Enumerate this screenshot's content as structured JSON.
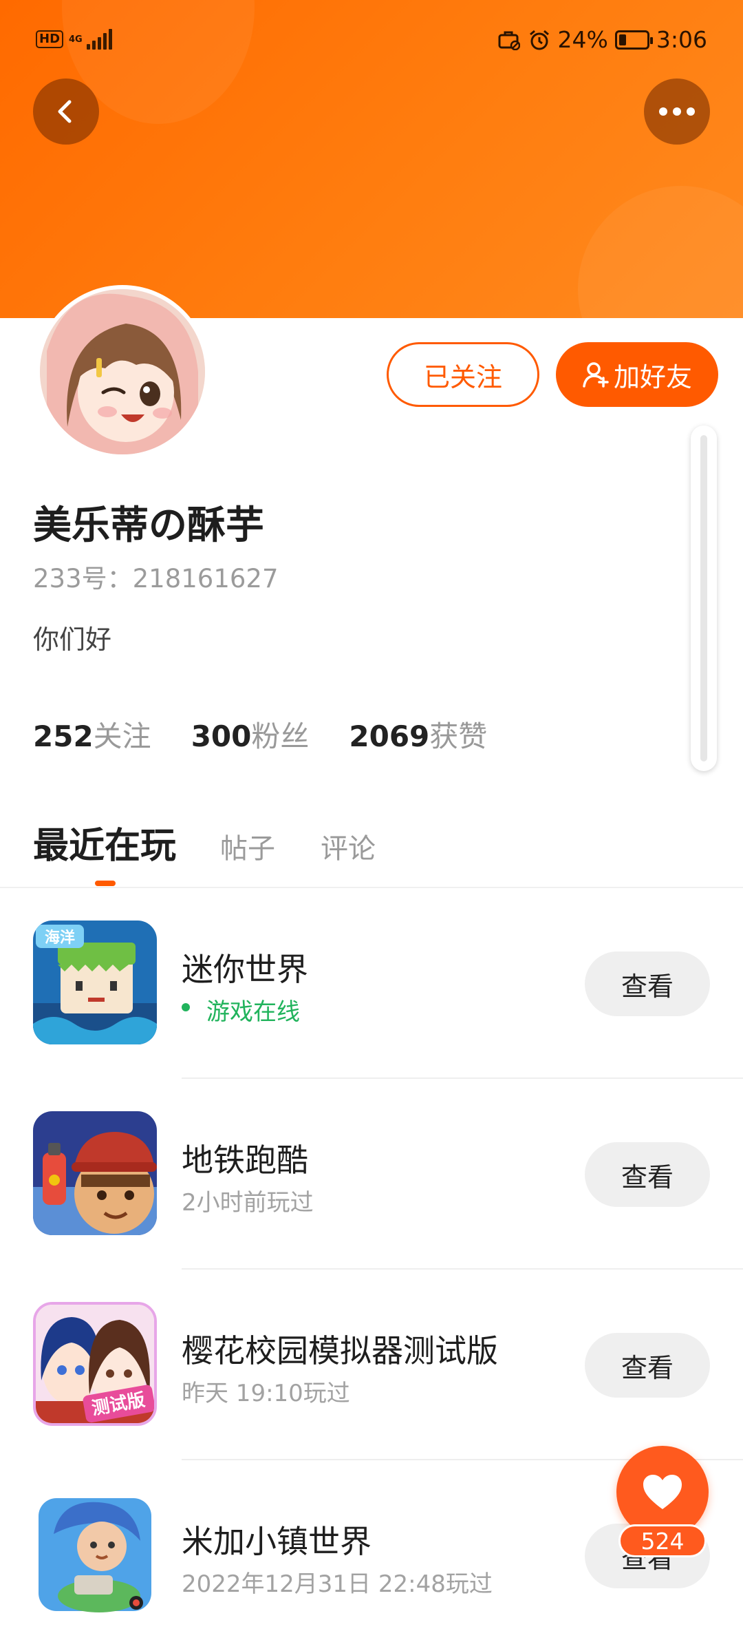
{
  "status_bar": {
    "left_badge": "HD",
    "network": "4G",
    "battery": "24%",
    "battery_level": 0.24,
    "time": "3:06",
    "icons": [
      "briefcase-off-icon",
      "alarm-icon",
      "battery-saver-icon"
    ]
  },
  "header": {
    "back_icon": "back-arrow-icon",
    "more_icon": "more-icon"
  },
  "profile": {
    "nickname": "美乐蒂の酥芋",
    "user_id": "233号：218161627",
    "bio": "你们好",
    "followed_button": "已关注",
    "add_friend_button": "加好友",
    "add_friend_icon": "add-user-icon"
  },
  "stats": [
    {
      "value": "252",
      "label": "关注"
    },
    {
      "value": "300",
      "label": "粉丝"
    },
    {
      "value": "2069",
      "label": "获赞"
    }
  ],
  "tabs": [
    {
      "label": "最近在玩",
      "active": true
    },
    {
      "label": "帖子",
      "active": false
    },
    {
      "label": "评论",
      "active": false
    }
  ],
  "games": [
    {
      "name": "迷你世界",
      "status": "游戏在线",
      "online": true,
      "action": "查看"
    },
    {
      "name": "地铁跑酷",
      "status": "2小时前玩过",
      "online": false,
      "action": "查看"
    },
    {
      "name": "樱花校园模拟器测试版",
      "status": "昨天 19:10玩过",
      "online": false,
      "action": "查看"
    },
    {
      "name": "米加小镇世界",
      "status": "2022年12月31日 22:48玩过",
      "online": false,
      "action": "查看"
    }
  ],
  "like": {
    "count": "524",
    "icon": "heart-icon"
  },
  "colors": {
    "accent": "#ff5a00",
    "header_orange": "#ff7d0f",
    "online_green": "#21b35c"
  }
}
